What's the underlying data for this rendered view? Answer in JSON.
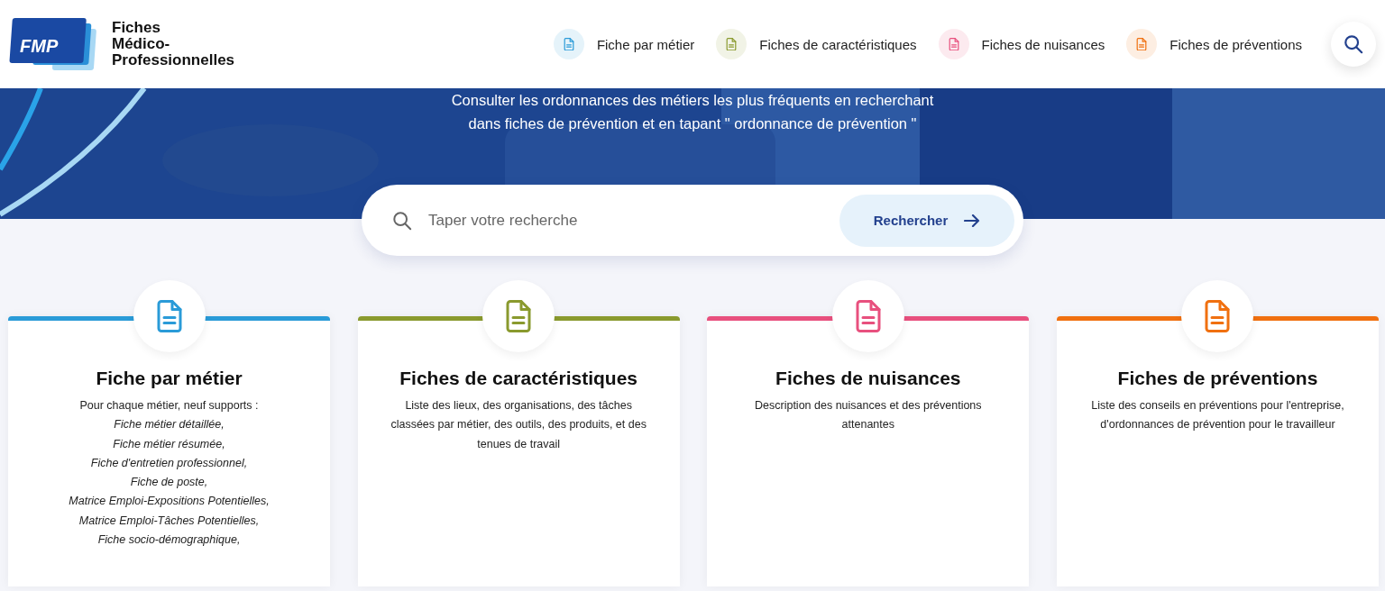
{
  "logo": {
    "mark": "FMP",
    "name_lines": [
      "Fiches",
      "Médico-",
      "Professionnelles"
    ]
  },
  "nav": [
    {
      "label": "Fiche par métier",
      "color": "#2a9bd8"
    },
    {
      "label": "Fiches de caractéristiques",
      "color": "#8a9a2e"
    },
    {
      "label": "Fiches de nuisances",
      "color": "#e8507e"
    },
    {
      "label": "Fiches de préventions",
      "color": "#f07010"
    }
  ],
  "hero": {
    "lines": [
      "Consulter les ordonnances des métiers les plus fréquents en recherchant",
      "dans fiches de prévention et en tapant \" ordonnance de prévention \""
    ]
  },
  "search": {
    "placeholder": "Taper votre recherche",
    "button": "Rechercher"
  },
  "cards": [
    {
      "title": "Fiche par métier",
      "color": "#2a9bd8",
      "intro": "Pour chaque métier, neuf supports :",
      "items": [
        "Fiche métier détaillée,",
        "Fiche métier résumée,",
        "Fiche d'entretien professionnel,",
        "Fiche de poste,",
        "Matrice Emploi-Expositions Potentielles,",
        "Matrice Emploi-Tâches Potentielles,",
        "Fiche socio-démographique,"
      ]
    },
    {
      "title": "Fiches de caractéristiques",
      "color": "#8a9a2e",
      "intro": "Liste des lieux, des organisations, des tâches classées par métier, des outils, des produits, et des tenues de travail"
    },
    {
      "title": "Fiches de nuisances",
      "color": "#e8507e",
      "intro": "Description des nuisances et des préventions attenantes"
    },
    {
      "title": "Fiches de préventions",
      "color": "#f07010",
      "intro": "Liste des conseils en préventions pour l'entreprise, d'ordonnances de prévention pour le travailleur"
    }
  ]
}
